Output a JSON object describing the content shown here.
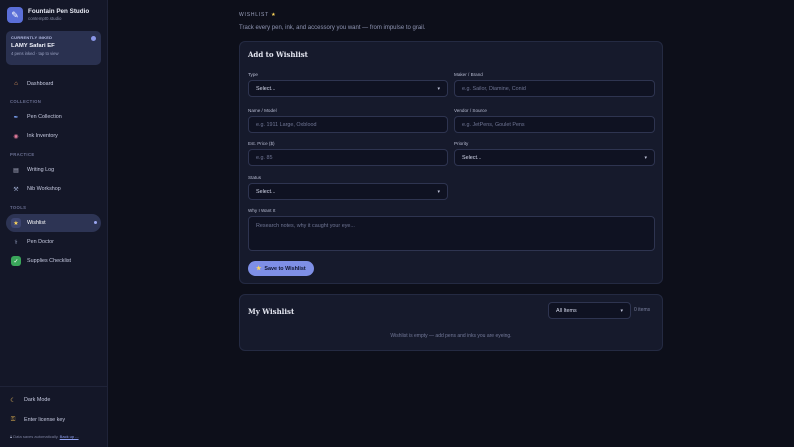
{
  "brand": {
    "title": "Fountain Pen Studio",
    "subtitle": "contempt0.studio"
  },
  "currently_inked": {
    "label": "CURRENTLY INKED",
    "pen": "LAMY Safari EF",
    "meta": "4 pens inked · tap to view"
  },
  "nav": {
    "dashboard": "Dashboard",
    "collection_section": "COLLECTION",
    "pen_collection": "Pen Collection",
    "ink_inventory": "Ink Inventory",
    "practice_section": "PRACTICE",
    "writing_log": "Writing Log",
    "nib_workshop": "Nib Workshop",
    "tools_section": "TOOLS",
    "wishlist": "Wishlist",
    "pen_doctor": "Pen Doctor",
    "supplies_checklist": "Supplies Checklist"
  },
  "bottom": {
    "dark_mode": "Dark Mode",
    "license": "Enter license key",
    "save_note": "Data saves automatically.",
    "backup_link": "Back up ..."
  },
  "page": {
    "eyebrow": "WISHLIST",
    "tagline": "Track every pen, ink, and accessory you want — from impulse to grail."
  },
  "form": {
    "title": "Add to Wishlist",
    "type_label": "Type",
    "type_value": "Select...",
    "maker_label": "Maker / Brand",
    "maker_placeholder": "e.g. Sailor, Diamine, Conid",
    "name_label": "Name / Model",
    "name_placeholder": "e.g. 1911 Large, Oxblood",
    "vendor_label": "Vendor / Source",
    "vendor_placeholder": "e.g. JetPens, Goulet Pens",
    "price_label": "Est. Price ($)",
    "price_placeholder": "e.g. 85",
    "priority_label": "Priority",
    "priority_value": "Select...",
    "status_label": "Status",
    "status_value": "Select...",
    "why_label": "Why I Want It",
    "why_placeholder": "Research notes, why it caught your eye...",
    "save_label": "Save to Wishlist"
  },
  "list": {
    "title": "My Wishlist",
    "filter_value": "All Items",
    "count": "0 items",
    "empty": "Wishlist is empty — add pens and inks you are eyeing."
  },
  "colors": {
    "accent": "#7e8fe6",
    "background": "#0d0f1a",
    "sidebar": "#141728",
    "card": "#161a2c"
  },
  "icons": [
    "pen-icon",
    "home-icon",
    "pen-nib-icon",
    "palette-icon",
    "notebook-icon",
    "wrench-icon",
    "star-icon",
    "stethoscope-icon",
    "checkbox-icon",
    "moon-icon",
    "key-icon",
    "lock-icon"
  ]
}
